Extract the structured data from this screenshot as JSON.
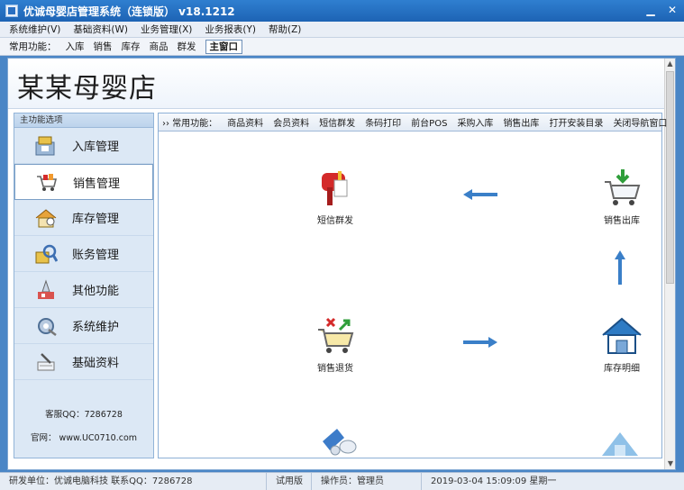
{
  "window": {
    "title": "优诚母婴店管理系统（连锁版）  v18.1212",
    "minimize": "▁",
    "close": "✕"
  },
  "menu": [
    "系统维护(V)",
    "基础资料(W)",
    "业务管理(X)",
    "业务报表(Y)",
    "帮助(Z)"
  ],
  "toolbar": {
    "label": "常用功能：",
    "items": [
      "入库",
      "销售",
      "库存",
      "商品",
      "群发"
    ],
    "main_window": "主窗口"
  },
  "banner": {
    "store_name": "某某母婴店"
  },
  "sidebar": {
    "title": "主功能选项",
    "items": [
      {
        "label": "入库管理",
        "icon": "inbound-icon",
        "active": false
      },
      {
        "label": "销售管理",
        "icon": "sales-icon",
        "active": true
      },
      {
        "label": "库存管理",
        "icon": "inventory-icon",
        "active": false
      },
      {
        "label": "账务管理",
        "icon": "accounting-icon",
        "active": false
      },
      {
        "label": "其他功能",
        "icon": "other-functions-icon",
        "active": false
      },
      {
        "label": "系统维护",
        "icon": "system-maintenance-icon",
        "active": false
      },
      {
        "label": "基础资料",
        "icon": "basic-data-icon",
        "active": false
      }
    ],
    "service_qq": "客服QQ：7286728",
    "website": "官网： www.UC0710.com"
  },
  "quickbar": [
    "›› 常用功能：",
    "商品资料",
    "会员资料",
    "短信群发",
    "条码打印",
    "前台POS",
    "采购入库",
    "销售出库",
    "打开安装目录",
    "关闭导航窗口"
  ],
  "flow": {
    "sms": "短信群发",
    "sales_out": "销售出库",
    "sales_return": "销售退货",
    "stock_detail": "库存明细"
  },
  "status": {
    "developer": "研发单位：优诚电脑科技    联系QQ：7286728",
    "edition": "试用版",
    "operator": "操作员：管理员",
    "datetime": "2019-03-04 15:09:09 星期一"
  },
  "colors": {
    "title_bar": "#1d63b4",
    "arrow_blue": "#3a7fc8",
    "cart_red": "#d42a2a",
    "green": "#2f9e3a"
  }
}
